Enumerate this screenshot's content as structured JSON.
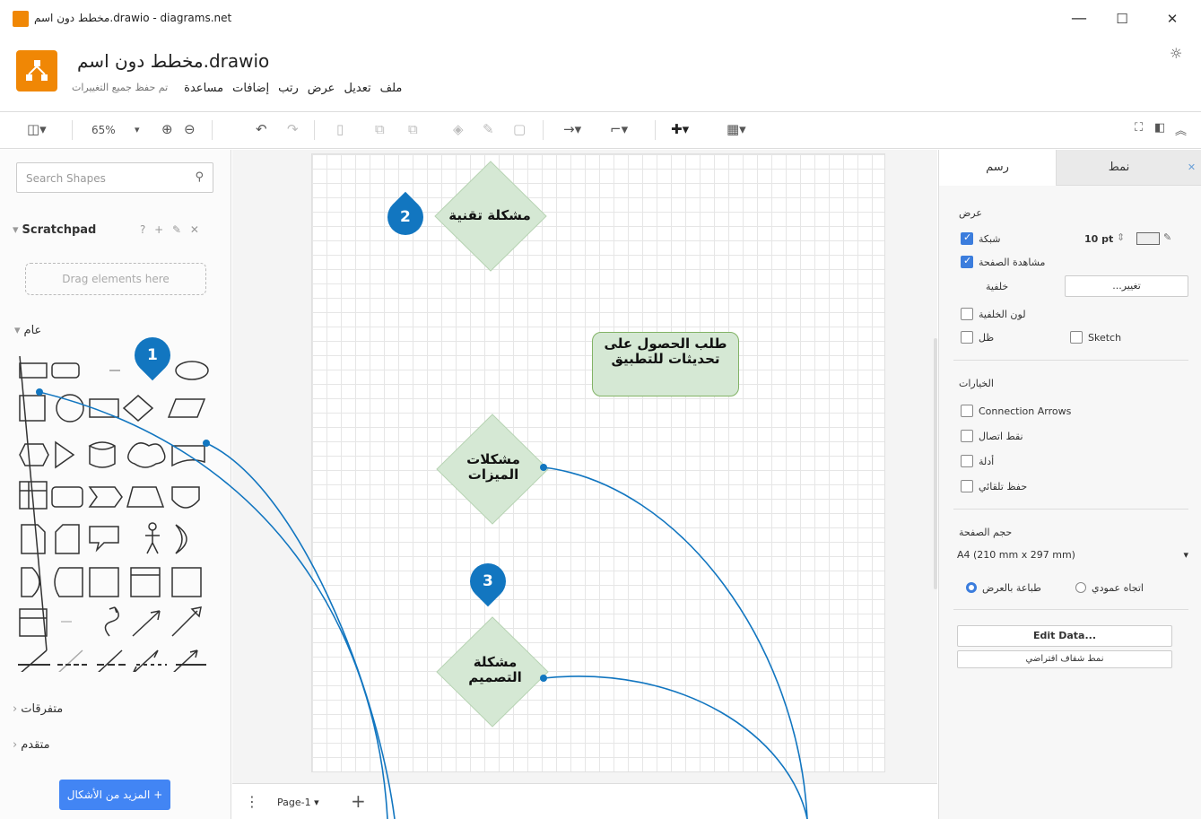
{
  "window": {
    "title": "مخطط دون اسم.drawio - diagrams.net",
    "minimize": "—",
    "maximize": "☐",
    "close": "✕"
  },
  "app": {
    "doc_title": "مخطط دون اسم.drawio",
    "brand_color": "#f08705"
  },
  "menu": {
    "items": [
      "ملف",
      "تعديل",
      "عرض",
      "رتب",
      "إضافات",
      "مساعدة"
    ],
    "saved_status": "تم حفظ جميع التغييرات"
  },
  "toolbar": {
    "zoom": "65%"
  },
  "sidebar": {
    "search_placeholder": "Search Shapes",
    "scratchpad_title": "Scratchpad",
    "scratchpad_tools": "? + ✎ ✕",
    "drop_hint": "Drag elements here",
    "general_title": "عام",
    "misc_title": "متفرقات",
    "advanced_title": "متقدم",
    "more_shapes": "المزيد من الأشكال +"
  },
  "canvas": {
    "nodes": [
      {
        "text": "مشكلة تقنية",
        "shape": "diamond"
      },
      {
        "text": "طلب الحصول على تحديثات للتطبيق",
        "shape": "rounded-rect"
      },
      {
        "text": "مشكلات الميزات",
        "shape": "diamond"
      },
      {
        "text": "مشكلة التصميم",
        "shape": "diamond"
      }
    ],
    "node_fill": "#d5e8d4",
    "node_stroke": "#82b366"
  },
  "pages": {
    "tab": "Page-1"
  },
  "right_panel": {
    "tab_diagram": "رسم",
    "tab_style": "نمط",
    "view_title": "عرض",
    "grid_label": "شبكة",
    "grid_size": "10 pt",
    "page_view_label": "مشاهدة الصفحة",
    "background_label": "خلفية",
    "change_button": "...تغيير",
    "background_color_label": "لون الخلفية",
    "shadow_label": "ظل",
    "sketch_label": "Sketch",
    "options_title": "الخيارات",
    "connection_arrows": "Connection Arrows",
    "connection_points": "نقط اتصال",
    "guides": "أدلة",
    "autosave": "حفظ تلقائي",
    "page_size_title": "حجم الصفحة",
    "page_size_value": "A4 (210 mm x 297 mm)",
    "portrait": "اتجاه عمودي",
    "landscape": "طباعة بالعرض",
    "edit_data": "Edit Data...",
    "clear_default": "نمط شفاف افتراضي"
  },
  "annotations": {
    "marker_1": "1",
    "marker_2": "2",
    "marker_3": "3",
    "color": "#1276c0"
  }
}
